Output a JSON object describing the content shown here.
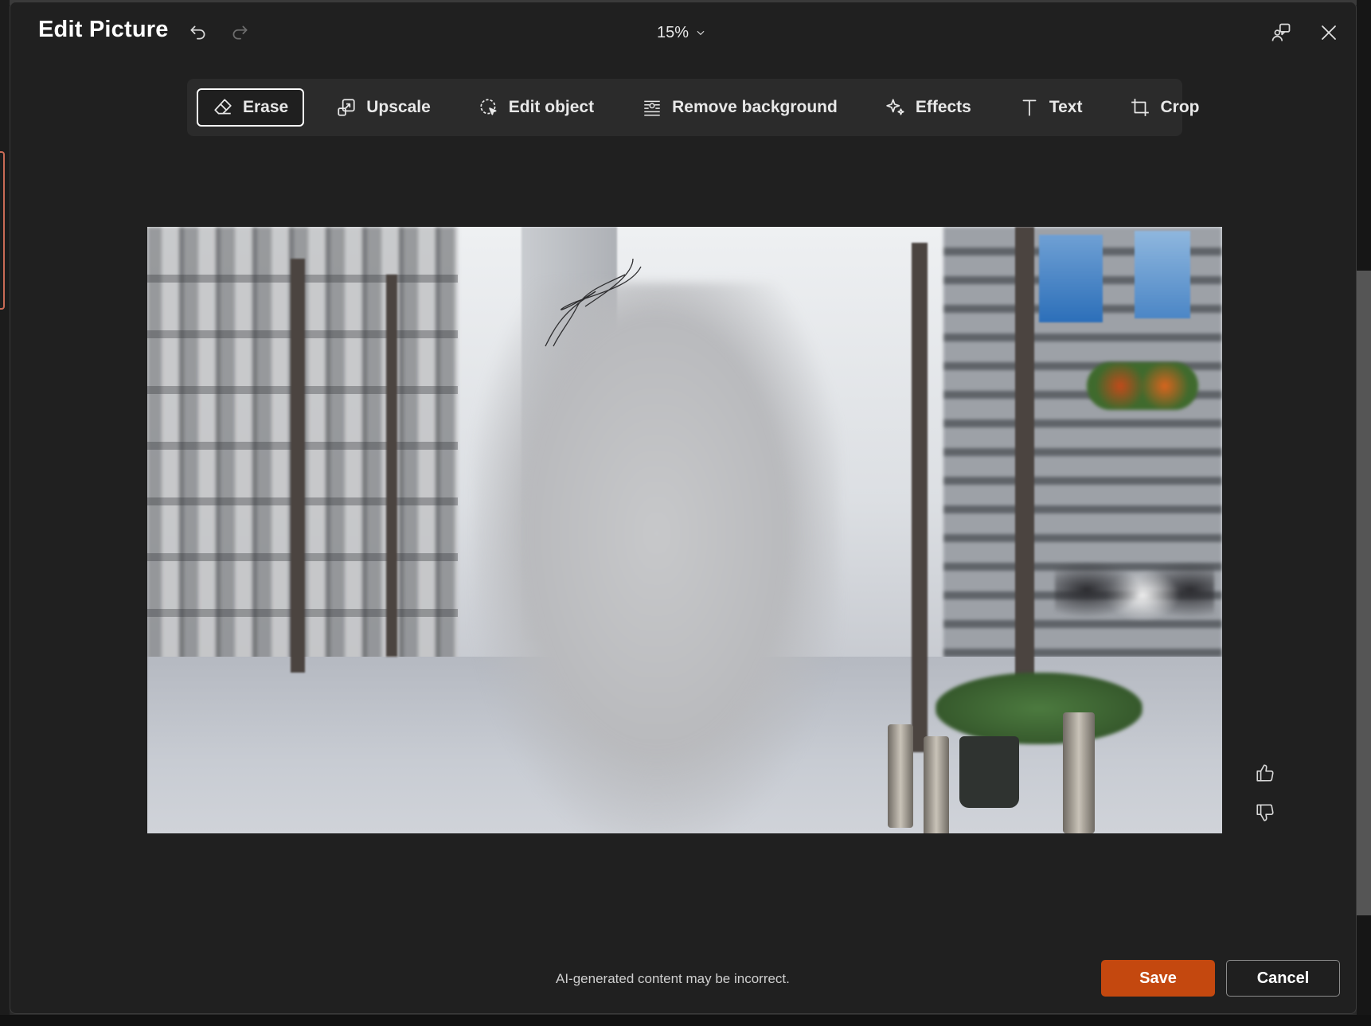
{
  "dialog": {
    "title": "Edit Picture",
    "zoom_label": "15%"
  },
  "toolbar": {
    "tools": [
      {
        "label": "Erase",
        "icon": "eraser-icon",
        "active": true
      },
      {
        "label": "Upscale",
        "icon": "upscale-icon"
      },
      {
        "label": "Edit object",
        "icon": "edit-object-icon"
      },
      {
        "label": "Remove background",
        "icon": "remove-background-icon"
      },
      {
        "label": "Effects",
        "icon": "sparkle-icon"
      },
      {
        "label": "Text",
        "icon": "text-icon"
      },
      {
        "label": "Crop",
        "icon": "crop-icon"
      }
    ]
  },
  "footer": {
    "disclaimer": "AI-generated content may be incorrect.",
    "save_label": "Save",
    "cancel_label": "Cancel"
  },
  "colors": {
    "accent": "#c4480f",
    "dialog_bg": "#202020",
    "toolbar_bg": "#2b2b2b"
  }
}
